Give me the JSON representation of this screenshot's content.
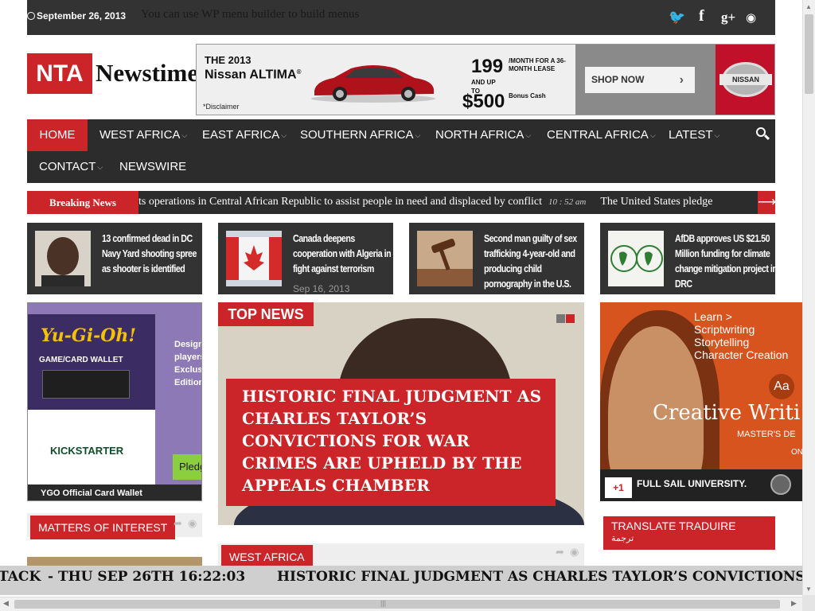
{
  "topbar": {
    "date": "September 26, 2013",
    "message": "You can use WP menu builder to build menus",
    "social_icons": [
      "twitter-icon",
      "facebook-icon",
      "google-plus-icon",
      "rss-icon"
    ],
    "social_glyphs": [
      "🐦",
      "f",
      "g+",
      "◉"
    ]
  },
  "logo": {
    "badge": "NTA",
    "word": "Newstime"
  },
  "ad_banner": {
    "year_line": "THE 2013",
    "model": "Nissan ALTIMA",
    "reg": "®",
    "price_monthly": "199",
    "per_month": "/MONTH FOR A 36-MONTH LEASE",
    "and_up_to": "AND UP TO",
    "bonus_price": "$500",
    "bonus_label": "Bonus Cash",
    "disclaimer": "*Disclaimer",
    "cta": "SHOP NOW",
    "brand": "NISSAN"
  },
  "nav": {
    "items": [
      {
        "label": "HOME",
        "dropdown": false
      },
      {
        "label": "WEST AFRICA",
        "dropdown": true
      },
      {
        "label": "EAST AFRICA",
        "dropdown": true
      },
      {
        "label": "SOUTHERN AFRICA",
        "dropdown": true
      },
      {
        "label": "NORTH AFRICA",
        "dropdown": true
      },
      {
        "label": "CENTRAL AFRICA",
        "dropdown": true
      },
      {
        "label": "LATEST",
        "dropdown": true
      },
      {
        "label": "CONTACT",
        "dropdown": true
      },
      {
        "label": "NEWSWIRE",
        "dropdown": false
      }
    ],
    "dropdown_glyph": "⌵"
  },
  "breaking": {
    "label": "Breaking News",
    "item1": "ts operations in Central African Republic to assist people in need and displaced by conflict",
    "time1": "10 : 52 am",
    "item2": "The United States pledge",
    "arrow": "⟶"
  },
  "featured": [
    {
      "title": "13 confirmed dead in DC Navy Yard shooting spree as shooter is identified",
      "date": ""
    },
    {
      "title": "Canada deepens cooperation with Algeria in fight against terrorism",
      "date": "Sep 16, 2013"
    },
    {
      "title": "Second man guilty of sex trafficking 4-year-old and producing child pornography in the U.S.",
      "date": ""
    },
    {
      "title": "AfDB approves US $21.50 Million funding for climate change mitigation project in DRC",
      "date": ""
    }
  ],
  "left_ad": {
    "logo": "Yu-Gi-Oh!",
    "subtitle": "GAME/CARD WALLET",
    "kickstarter": "KICKSTARTER",
    "desc_lines": [
      "Designe",
      "players lik",
      "Exclusive,",
      "Edition R"
    ],
    "pledge": "Pledge",
    "footer": "YGO Official Card Wallet"
  },
  "top_news": {
    "label": "TOP NEWS",
    "title": "HISTORIC FINAL JUDGMENT AS CHARLES TAYLOR’S CONVICTIONS FOR WAR CRIMES ARE UPHELD BY THE APPEALS CHAMBER",
    "dots": [
      "#777777",
      "#cc2529"
    ]
  },
  "right_ad": {
    "learn_lines": [
      "Learn >",
      "Scriptwriting",
      "Storytelling",
      "Character Creation"
    ],
    "badge": "Aa",
    "headline": "Creative Writi",
    "degree": "MASTER'S DE",
    "online": "ON",
    "gplus": "+1",
    "school": "FULL SAIL UNIVERSITY."
  },
  "sections": {
    "matters": "MATTERS OF INTEREST",
    "west_africa": "WEST AFRICA",
    "translate_line1": "TRANSLATE TRADUIRE",
    "translate_line2": "ترجمة"
  },
  "bottom_ticker": {
    "part1": "TACK",
    "part2": "- THU SEP 26TH 16:22:03",
    "part3": "HISTORIC FINAL JUDGMENT AS CHARLES TAYLOR’S CONVICTIONS FOR"
  },
  "colors": {
    "accent": "#cc2529",
    "dark": "#2c2c2c",
    "topbar": "#333333"
  }
}
